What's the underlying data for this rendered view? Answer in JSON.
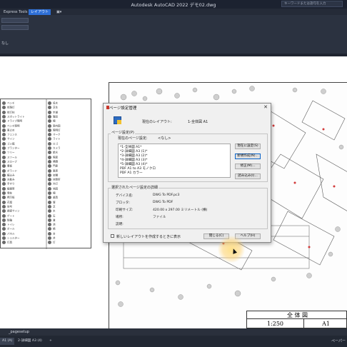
{
  "titlebar": {
    "title": "Autodesk AutoCAD 2022   デモ02.dwg",
    "search_placeholder": "キーワードまたは語句を入力"
  },
  "tabs": [
    {
      "label": "Express Tools"
    },
    {
      "label": "レイアウト"
    },
    {
      "label": "▣▾"
    }
  ],
  "ribbon": {
    "label_small": "なし"
  },
  "legend": {
    "rows": [
      "ベンチ",
      "街路灯",
      "街灯柱",
      "スポットライト",
      "ドライブ照明",
      "ベンチ照明",
      "車止め",
      "フェンス",
      "サイン",
      "ゴミ箱",
      "プランター",
      "ツリー",
      "スツール",
      "スロープ",
      "看板",
      "ボラード",
      "植込み",
      "水飲み",
      "手すり",
      "植樹帯",
      "電柱",
      "掲示板",
      "花壇",
      "信号",
      "誘導サイン",
      "ゲート",
      "駐輪",
      "トイレ",
      "ポール",
      "パネル",
      "シェルター",
      "灯具"
    ],
    "rows_right": [
      "低木",
      "芝生",
      "歩道",
      "階段",
      "柵",
      "案内図",
      "照明灯",
      "マーク",
      "ライト",
      "ロゴ",
      "カメラ",
      "給水",
      "照度",
      "標識",
      "門扉",
      "車庫",
      "店舗",
      "休憩所",
      "外灯",
      "地図",
      "柵",
      "遊具",
      "塀",
      "芝",
      "木",
      "石",
      "道",
      "池",
      "橋",
      "台",
      "井",
      "灯"
    ]
  },
  "dialog": {
    "title": "ページ設定管理",
    "close": "✕",
    "current_layout_label": "現在のレイアウト:",
    "current_layout_value": "1-全体図 A1",
    "page_setup_group": "ページ設定(P)",
    "current_page_setup_label": "現在のページ設定:",
    "current_page_setup_value": "<なし>",
    "list_items": [
      "*1-全体図 A1*",
      "*2-詳細図 A3 (1)*",
      "*3-詳細図 A3 (2)*",
      "*4-詳細図 A3 (3)*",
      "*5-詳細図 A3 (4)*",
      "PDF A1 to A3 モノクロ",
      "PDF A1 カラー"
    ],
    "btn_set_current": "現在に設定(S)",
    "btn_new": "新規作成(N)...",
    "btn_modify": "修正(M)...",
    "btn_import": "読み込み(I)...",
    "details_title": "選択されたページ設定の詳細",
    "details": [
      {
        "k": "デバイス名:",
        "v": "DWG To PDF.pc3"
      },
      {
        "k": "プロッタ:",
        "v": "DWG To PDF"
      },
      {
        "k": "印刷サイズ:",
        "v": "420.00 x 297.00 ミリメートル (横)"
      },
      {
        "k": "場所:",
        "v": "ファイル"
      },
      {
        "k": "説明:",
        "v": ""
      }
    ],
    "checkbox_label": "新しいレイアウトを作成するときに表示",
    "btn_close": "閉じる(C)",
    "btn_help": "ヘルプ(H)"
  },
  "titleblock": {
    "title": "全 体 図",
    "scale": "1:250",
    "size": "A1"
  },
  "command": {
    "text": "_pagesetup"
  },
  "layout_tabs": [
    "A1 (A)",
    "2-詳細図 A3 (4)",
    "+"
  ],
  "status": {
    "paper": "ペーパー"
  }
}
